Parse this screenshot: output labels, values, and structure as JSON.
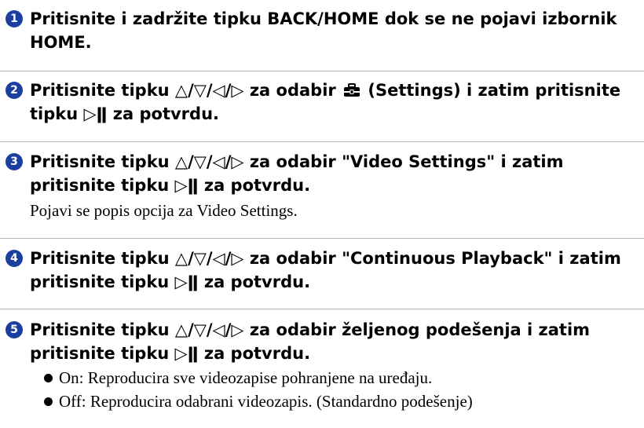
{
  "steps": [
    {
      "number": "1",
      "lines": [
        "Pritisnite i zadržite tipku BACK/HOME dok se ne pojavi izbornik",
        "HOME."
      ]
    },
    {
      "number": "2",
      "line1_before": "Pritisnite tipku △/▽/◁/▷ za odabir",
      "line1_after": "(Settings) i zatim pritisnite",
      "line2": "tipku ▷ǁ za potvrdu.",
      "icon": "toolbox-icon"
    },
    {
      "number": "3",
      "lines": [
        "Pritisnite tipku △/▽/◁/▷ za odabir \"Video Settings\" i zatim",
        "pritisnite tipku ▷ǁ za potvrdu."
      ],
      "body": "Pojavi se popis opcija za Video Settings."
    },
    {
      "number": "4",
      "lines": [
        "Pritisnite tipku △/▽/◁/▷ za odabir \"Continuous Playback\" i zatim",
        "pritisnite tipku ▷ǁ za potvrdu."
      ]
    },
    {
      "number": "5",
      "lines": [
        "Pritisnite tipku △/▽/◁/▷ za odabir željenog podešenja i zatim",
        "pritisnite tipku ▷ǁ za potvrdu."
      ],
      "bullets": [
        "On: Reproducira sve videozapise pohranjene na uređaju.",
        "Off: Reproducira odabrani videozapis. (Standardno podešenje)"
      ]
    }
  ],
  "colors": {
    "step_number_bg": "#1b3fa0",
    "divider": "#b5b5b5"
  }
}
